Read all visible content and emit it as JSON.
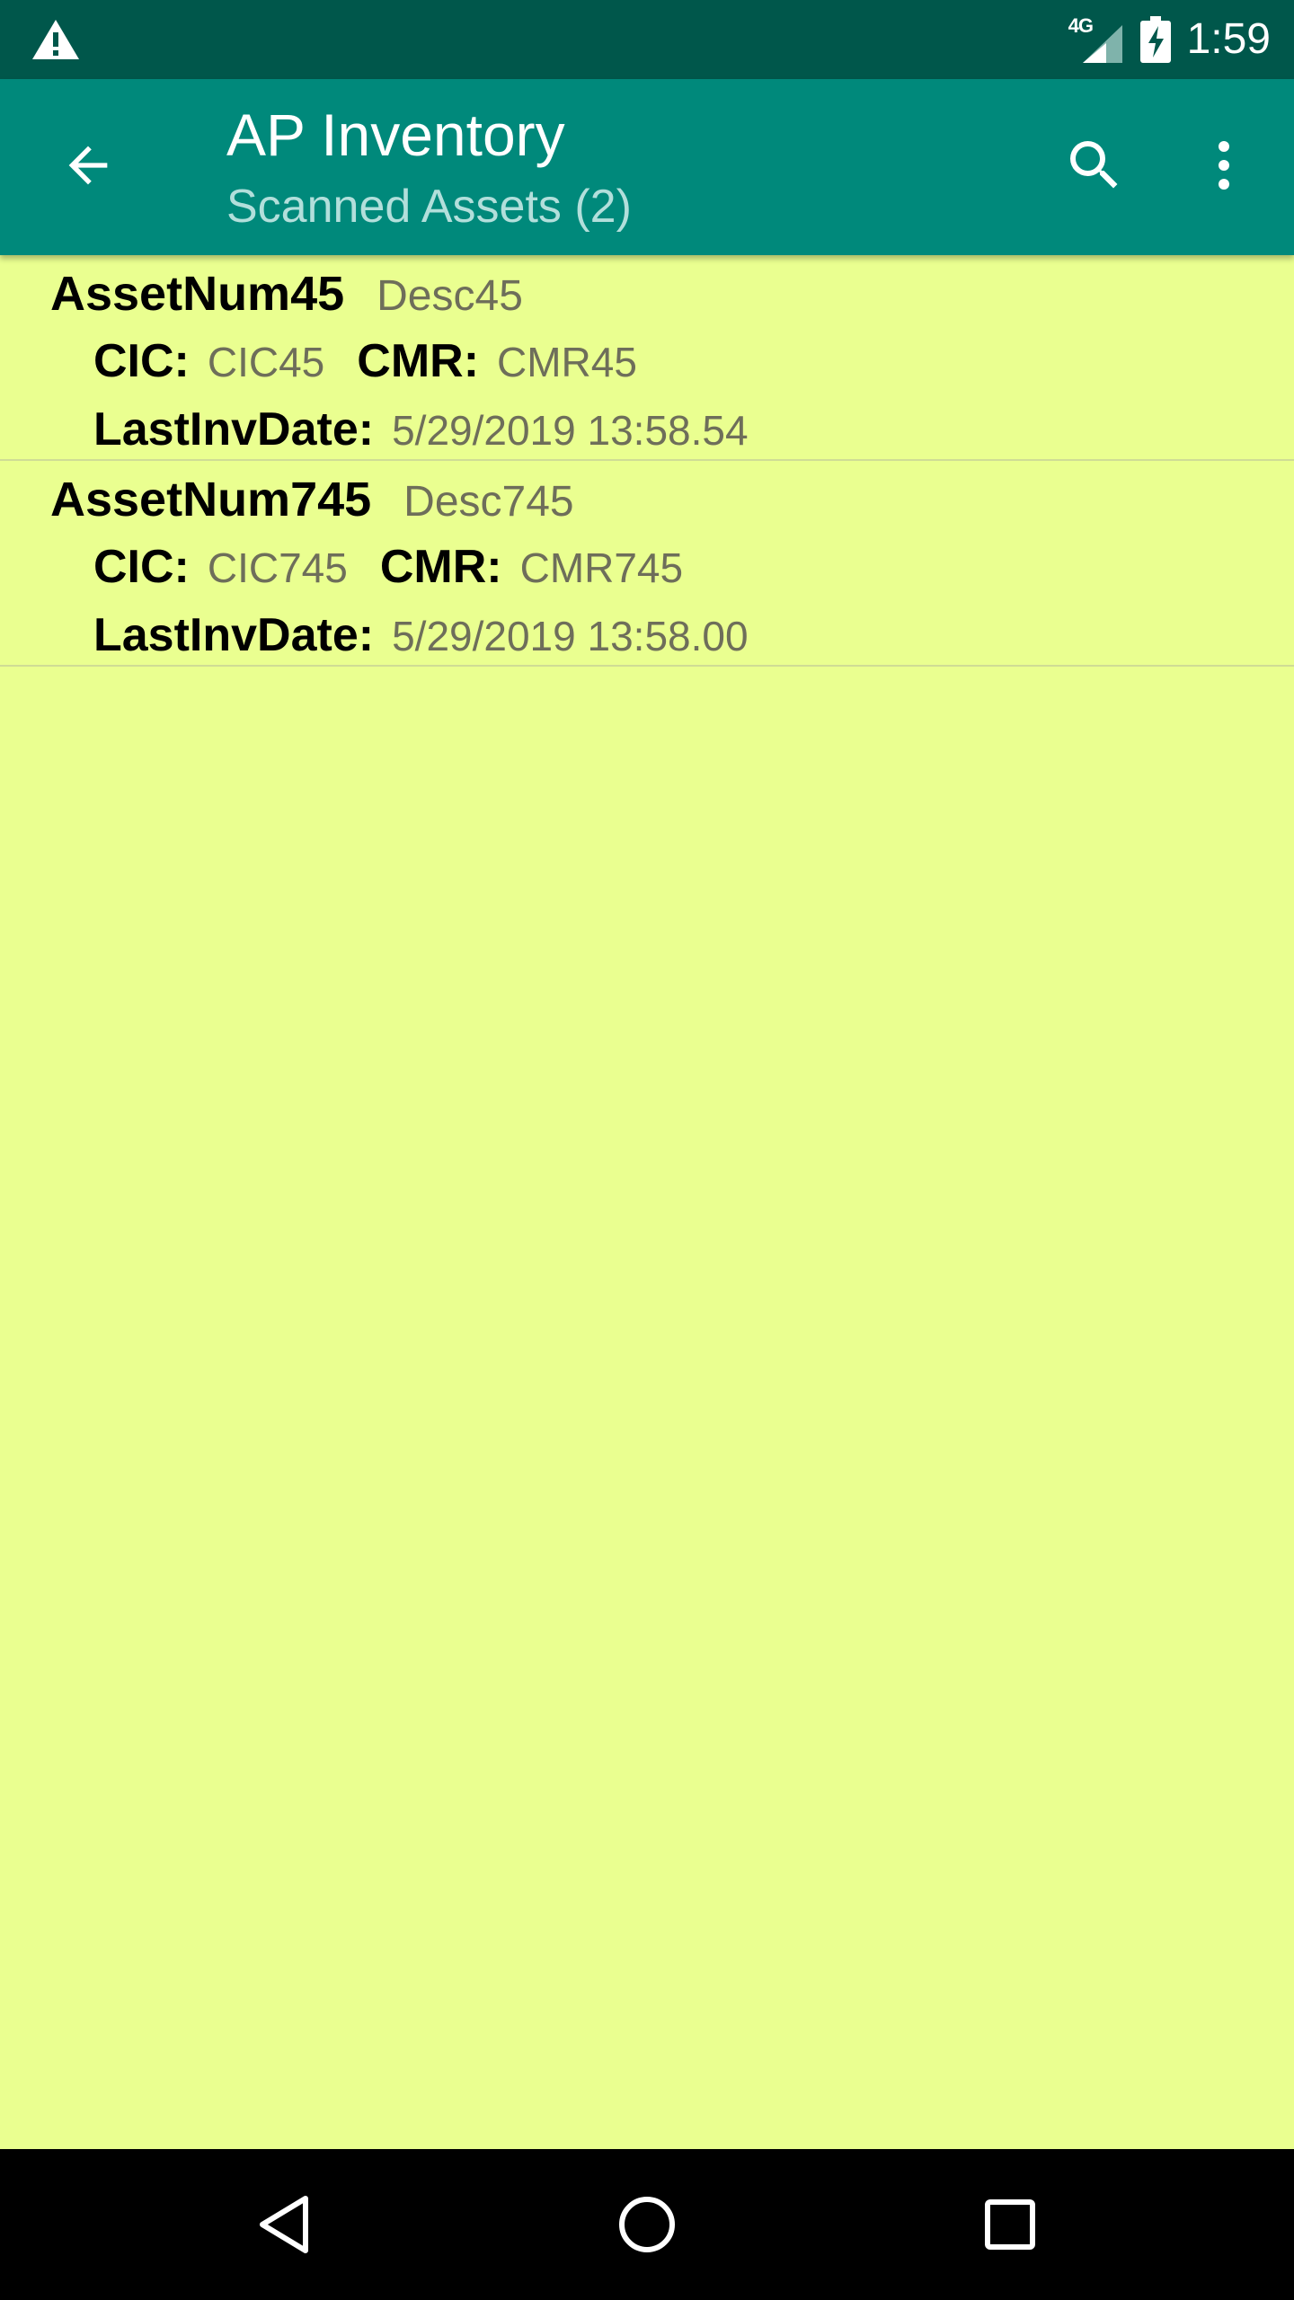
{
  "status_bar": {
    "network_label": "4G",
    "time": "1:59"
  },
  "app_bar": {
    "title": "AP Inventory",
    "subtitle": "Scanned Assets (2)"
  },
  "labels": {
    "cic": "CIC:",
    "cmr": "CMR:",
    "last_inv_date": "LastInvDate:"
  },
  "assets": [
    {
      "num": "AssetNum45",
      "desc": "Desc45",
      "cic": "CIC45",
      "cmr": "CMR45",
      "last_inv_date": "5/29/2019 13:58.54"
    },
    {
      "num": "AssetNum745",
      "desc": "Desc745",
      "cic": "CIC745",
      "cmr": "CMR745",
      "last_inv_date": "5/29/2019 13:58.00"
    }
  ],
  "icons": {
    "status_warning": "warning-icon",
    "signal": "signal-icon",
    "battery": "battery-charging-icon",
    "back": "arrow-back-icon",
    "search": "search-icon",
    "more": "more-vert-icon",
    "nav_back": "nav-back-triangle-icon",
    "nav_home": "nav-home-circle-icon",
    "nav_recent": "nav-recent-square-icon"
  },
  "colors": {
    "status_bar": "#00574b",
    "app_bar": "#00897b",
    "list_background": "#eaff90",
    "subtitle": "#b2dfdb",
    "nav_bar": "#000000"
  }
}
